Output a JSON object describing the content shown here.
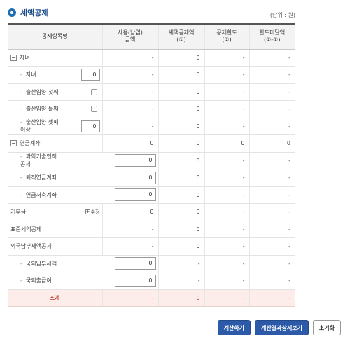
{
  "title": "세액공제",
  "unit": "(단위 : 원)",
  "headers": {
    "item": "공제항목명",
    "paid": "사용(납입)\n금액",
    "credit": "세액공제액\n(①)",
    "limit": "공제한도\n(②)",
    "excess": "한도미달액\n(②-①)"
  },
  "rows": {
    "child_group": {
      "toggle": "−",
      "label": "자녀",
      "paid": "-",
      "credit": "0",
      "limit": "-",
      "excess": "-"
    },
    "child": {
      "label": "자녀",
      "input": "0",
      "paid": "-",
      "credit": "0",
      "limit": "-",
      "excess": "-"
    },
    "birth1": {
      "label": "출산입양 첫째",
      "paid": "-",
      "credit": "0",
      "limit": "-",
      "excess": "-"
    },
    "birth2": {
      "label": "출산입양 둘째",
      "paid": "-",
      "credit": "0",
      "limit": "-",
      "excess": "-"
    },
    "birth3": {
      "label": "출산입양 셋째\n이상",
      "input": "0",
      "paid": "-",
      "credit": "0",
      "limit": "-",
      "excess": "-"
    },
    "pension_group": {
      "toggle": "−",
      "label": "연금계좌",
      "paid": "0",
      "credit": "0",
      "limit": "0",
      "excess": "0"
    },
    "sci_mutual": {
      "label": "과학기술인적\n공제",
      "input": "0",
      "credit": "0",
      "limit": "-",
      "excess": "-"
    },
    "retire_pension": {
      "label": "퇴직연금계좌",
      "input": "0",
      "credit": "0",
      "limit": "-",
      "excess": "-"
    },
    "pension_saving": {
      "label": "연금저축계좌",
      "input": "0",
      "credit": "0",
      "limit": "-",
      "excess": "-"
    },
    "donation": {
      "label": "기부금",
      "action": "수정",
      "paid": "0",
      "credit": "0",
      "limit": "-",
      "excess": "-"
    },
    "standard": {
      "label": "표준세액공제",
      "paid": "-",
      "credit": "0",
      "limit": "-",
      "excess": "-"
    },
    "foreign_group": {
      "label": "외국납부세액공제",
      "paid": "-",
      "credit": "0",
      "limit": "-",
      "excess": "-"
    },
    "foreign_tax": {
      "label": "국외납부세액",
      "input": "0",
      "credit": "-",
      "limit": "-",
      "excess": "-"
    },
    "foreign_salary": {
      "label": "국외출급여",
      "input": "0",
      "credit": "-",
      "limit": "-",
      "excess": "-"
    },
    "subtotal": {
      "label": "소계",
      "paid": "-",
      "credit": "0",
      "limit": "-",
      "excess": "-"
    }
  },
  "buttons": {
    "calculate": "계산하기",
    "details": "계산결과상세보기",
    "reset": "초기화"
  },
  "colors": {
    "accent": "#2c5aa8",
    "subtotal_text": "#c0392b",
    "subtotal_bg": "#fcecea"
  }
}
